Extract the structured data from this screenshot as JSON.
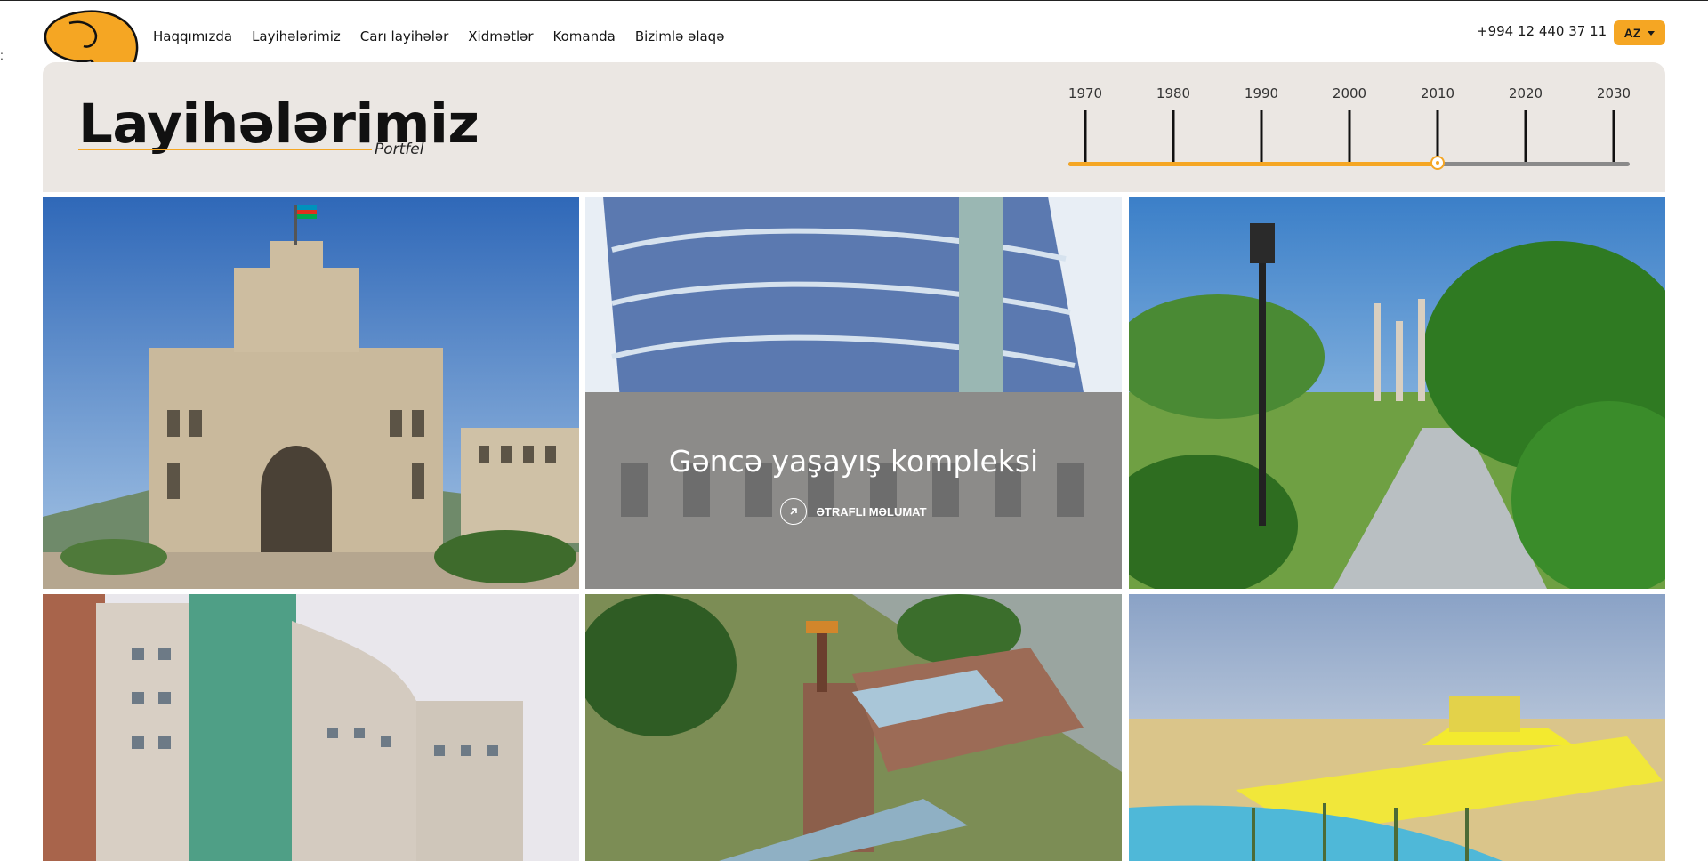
{
  "header": {
    "nav": [
      "Haqqımızda",
      "Layihələrimiz",
      "Carı layihələr",
      "Xidmətlər",
      "Komanda",
      "Bizimlə əlaqə"
    ],
    "phone": "+994 12 440 37 11",
    "language": "AZ"
  },
  "hero": {
    "title": "Layihələrimiz",
    "subtitle": "Portfel"
  },
  "timeline": {
    "years": [
      "1970",
      "1980",
      "1990",
      "2000",
      "2010",
      "2020",
      "2030"
    ],
    "selected_year": "2010",
    "progress_fraction": 0.667
  },
  "gallery": {
    "projects": [
      {
        "title": ""
      },
      {
        "title": "Gəncə yaşayış kompleksi",
        "more_label": "ƏTRAFLI MƏLUMAT"
      },
      {
        "title": ""
      },
      {
        "title": ""
      },
      {
        "title": ""
      },
      {
        "title": ""
      }
    ]
  },
  "colors": {
    "accent": "#f5a623",
    "band": "#ebe7e3"
  }
}
